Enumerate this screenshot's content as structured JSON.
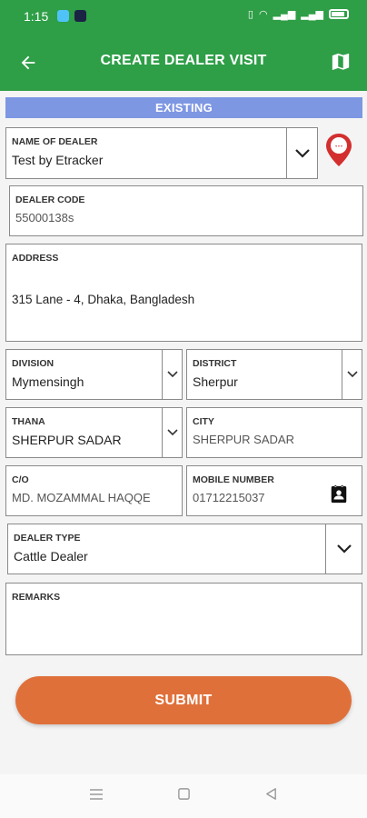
{
  "status_bar": {
    "time": "1:15"
  },
  "app_bar": {
    "title": "CREATE DEALER VISIT",
    "back_icon": "arrow-left-icon",
    "map_icon": "map-icon"
  },
  "banner": {
    "label": "EXISTING"
  },
  "form": {
    "name_of_dealer": {
      "label": "NAME OF DEALER",
      "value": "Test by Etracker"
    },
    "dealer_code": {
      "label": "DEALER CODE",
      "value": "55000138s"
    },
    "address": {
      "label": "ADDRESS",
      "value": "315 Lane - 4, Dhaka, Bangladesh"
    },
    "division": {
      "label": "DIVISION",
      "value": "Mymensingh"
    },
    "district": {
      "label": "DISTRICT",
      "value": "Sherpur"
    },
    "thana": {
      "label": "THANA",
      "value": "SHERPUR SADAR"
    },
    "city": {
      "label": "CITY",
      "value": "SHERPUR SADAR"
    },
    "co": {
      "label": "C/O",
      "value": "MD. MOZAMMAL HAQQE"
    },
    "mobile_number": {
      "label": "MOBILE NUMBER",
      "value": "01712215037"
    },
    "dealer_type": {
      "label": "DEALER TYPE",
      "value": "Cattle Dealer"
    },
    "remarks": {
      "label": "REMARKS",
      "value": ""
    }
  },
  "submit": {
    "label": "SUBMIT"
  },
  "colors": {
    "primary_green": "#2e9e47",
    "banner_blue": "#7e97e3",
    "submit_orange": "#e0703a",
    "pin_red": "#d32f2f"
  }
}
